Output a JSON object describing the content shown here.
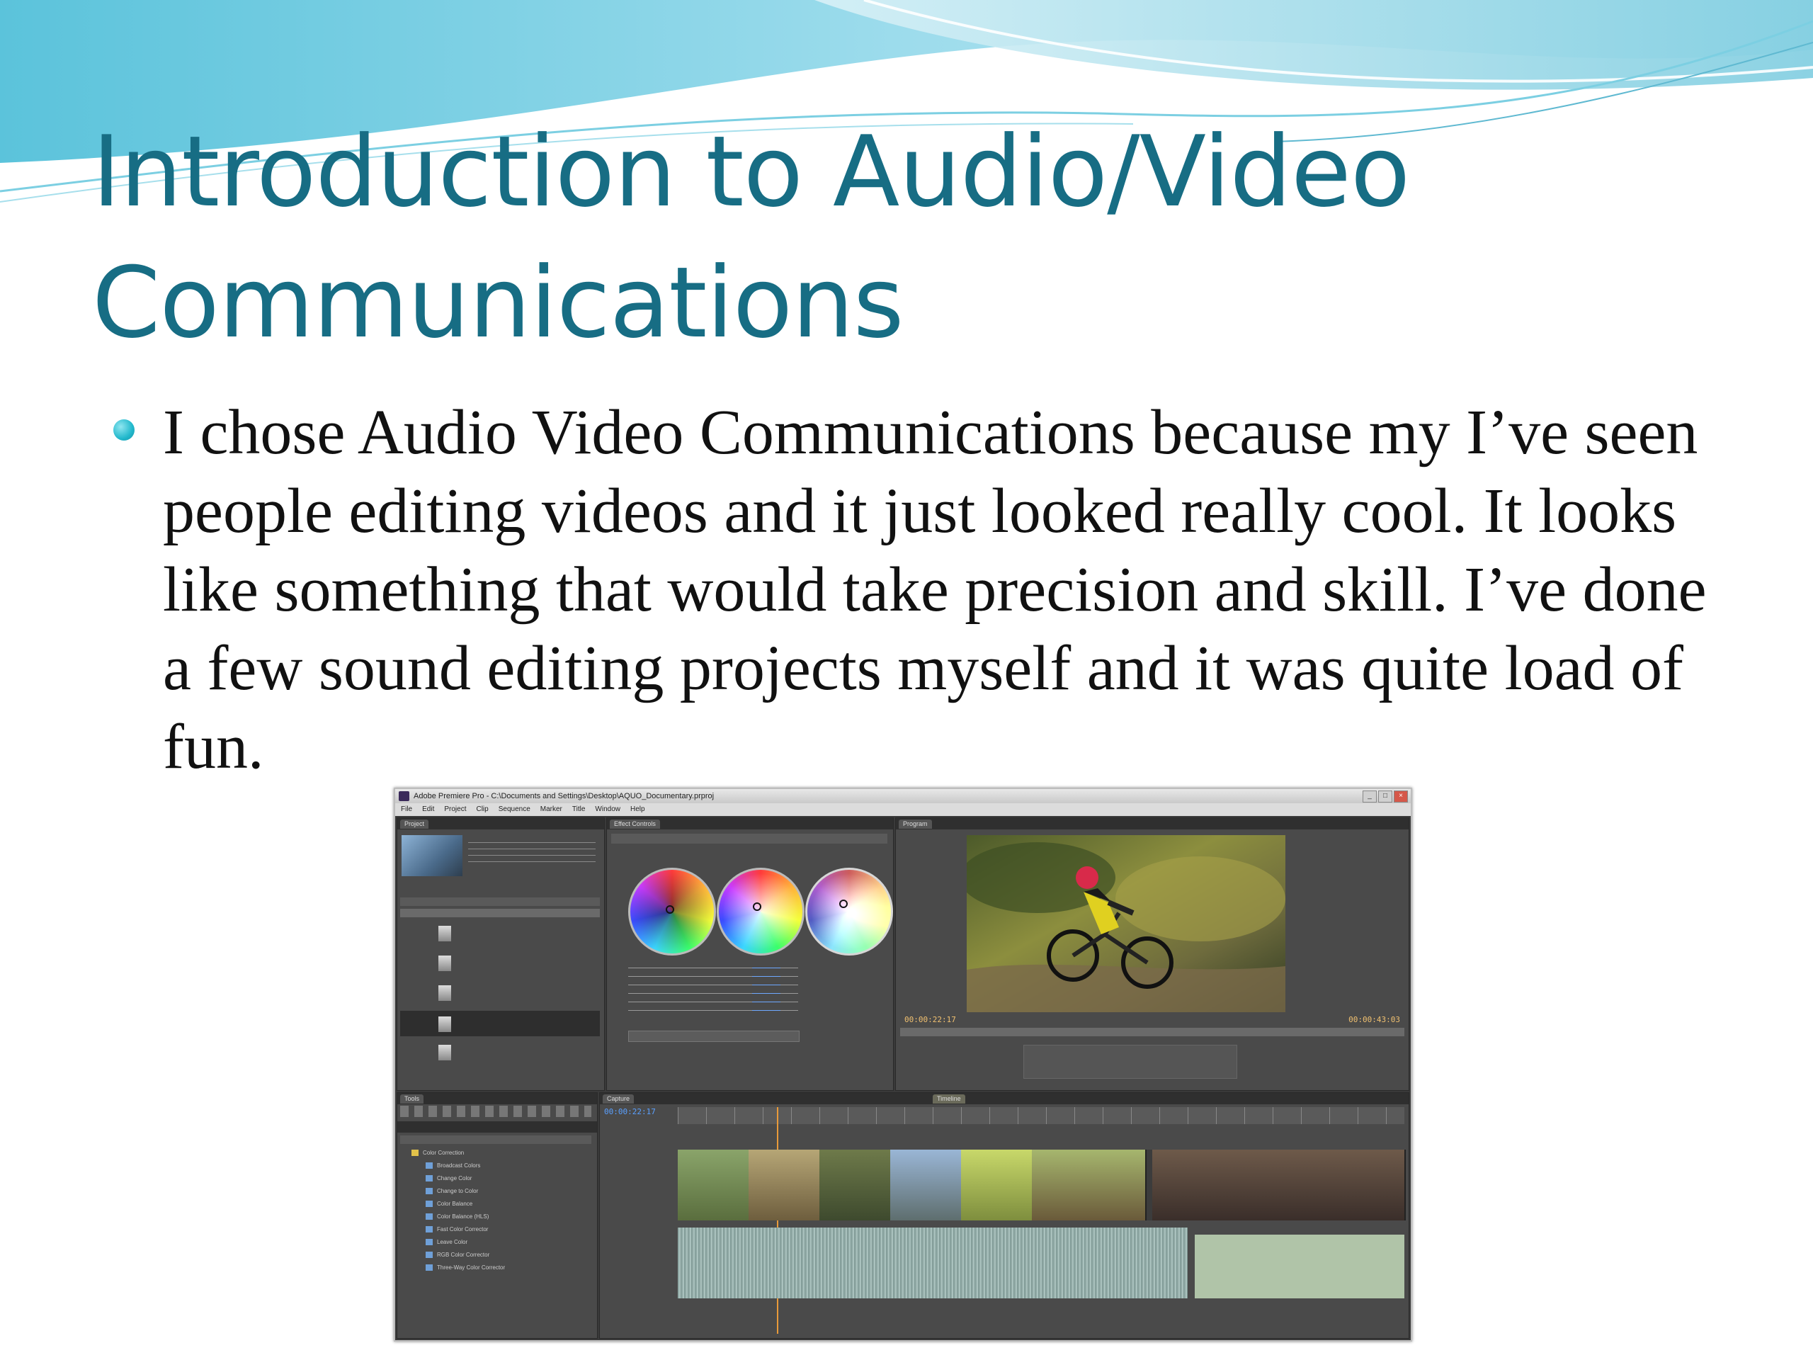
{
  "slide": {
    "title": "Introduction to Audio/Video Communications",
    "bullets": [
      {
        "text": "I chose Audio Video Communications because my I’ve seen people editing videos and it just looked really cool. It looks like something that would take precision and skill. I’ve done a few sound editing projects myself and it was quite load of fun."
      }
    ]
  },
  "colors": {
    "title": "#176d84",
    "bullet": "#22b8cc",
    "wave_light": "#bfe8f2",
    "wave_mid": "#6cc6dc"
  },
  "screenshot": {
    "window_title": "Adobe Premiere Pro - C:\\Documents and Settings\\Desktop\\AQUO_Documentary.prproj",
    "menu": [
      "File",
      "Edit",
      "Project",
      "Clip",
      "Sequence",
      "Marker",
      "Title",
      "Window",
      "Help"
    ],
    "program_timecode_left": "00:00:22:17",
    "program_timecode_right": "00:00:43:03",
    "timeline_timecode": "00:00:22:17"
  }
}
